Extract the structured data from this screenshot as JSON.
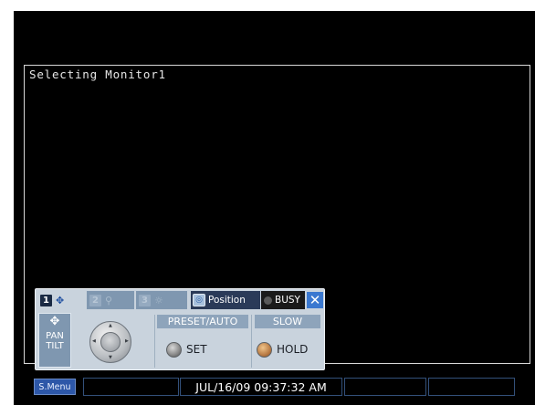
{
  "monitor": {
    "label": "Selecting Monitor1"
  },
  "ptz_panel": {
    "tabs": [
      {
        "number": "1",
        "icon": "pan-tilt-arrows-icon",
        "active": true
      },
      {
        "number": "2",
        "icon": "zoom-magnifier-icon",
        "active": false
      },
      {
        "number": "3",
        "icon": "brightness-sun-icon",
        "active": false
      }
    ],
    "position_label": "Position",
    "busy_label": "BUSY",
    "pan_tilt_label": "PAN\nTILT",
    "preset_auto_label": "PRESET/AUTO",
    "slow_label": "SLOW",
    "set_label": "SET",
    "hold_label": "HOLD"
  },
  "statusbar": {
    "smenu_label": "S.Menu",
    "datetime": "JUL/16/09 09:37:32 AM"
  }
}
